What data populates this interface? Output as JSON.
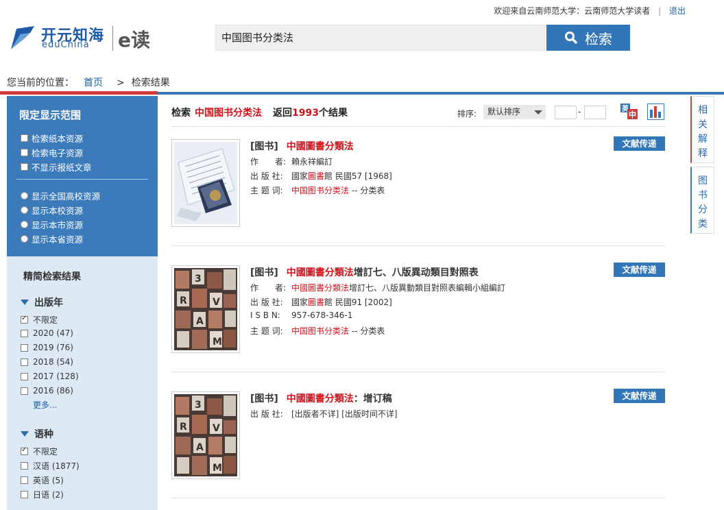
{
  "topbar": {
    "welcome": "欢迎来自云南师范大学：云南师范大学读者",
    "separator": "|",
    "logout": "退出"
  },
  "logo": {
    "cn_text": "开元知海",
    "en_text": "eduChina",
    "product": "e读"
  },
  "search": {
    "query": "中国图书分类法",
    "button_label": "检索"
  },
  "breadcrumb": {
    "prefix": "您当前的位置：",
    "home": "首页",
    "separator": ">",
    "current": "检索结果"
  },
  "filter_panel": {
    "title": "限定显示范围",
    "checkboxes": [
      "检索纸本资源",
      "检索电子资源",
      "不显示报纸文章"
    ],
    "radios": [
      "显示全国高校资源",
      "显示本校资源",
      "显示本市资源",
      "显示本省资源"
    ]
  },
  "refine_panel": {
    "title": "精简检索结果",
    "year_facet": {
      "label": "出版年",
      "options": [
        "不限定",
        "2020 (47)",
        "2019 (76)",
        "2018 (54)",
        "2017 (128)",
        "2016 (86)"
      ],
      "more": "更多..."
    },
    "lang_facet": {
      "label": "语种",
      "options": [
        "不限定",
        "汉语 (1877)",
        "英语 (5)",
        "日语 (2)"
      ]
    }
  },
  "results_header": {
    "prefix": "检索",
    "keyword": "中国图书分类法",
    "returned": "返回",
    "count": "1993",
    "suffix": "个结果",
    "sort_label": "排序:",
    "sort_value": "默认排序",
    "range_dash": "-"
  },
  "results": [
    {
      "type": "[图书]",
      "title_hl": "中國圖書分類法",
      "title_rest": "",
      "deliver": "文献传递",
      "author_label": "作　　者:",
      "author": "賴永祥編訂",
      "publisher_label": "出 版 社:",
      "publisher_pre": "國家",
      "publisher_hl": "圖書",
      "publisher_post": "館 民國57 [1968]",
      "subject_label": "主 题 词:",
      "subject_hl": "中国图书分类法",
      "subject_rest": "-- 分类表"
    },
    {
      "type": "[图书]",
      "title_hl": "中國圖書分類法",
      "title_rest": "增訂七、八版異动類目對照表",
      "deliver": "文献传递",
      "author_label": "作　　者:",
      "author_hl": "中國圖書分類法",
      "author_rest": "增訂七、八版異動類目對照表編輯小組編訂",
      "publisher_label": "出 版 社:",
      "publisher_pre": "國家",
      "publisher_hl": "圖書",
      "publisher_post": "館 民國91 [2002]",
      "isbn_label": "I S B N:",
      "isbn": "957-678-346-1",
      "subject_label": "主 题 词:",
      "subject_hl": "中国图书分类法",
      "subject_rest": "-- 分类表"
    },
    {
      "type": "[图书]",
      "title_hl": "中國圖書分類法",
      "title_rest": "：增订稿",
      "deliver": "文献传递",
      "publisher_label": "出 版 社:",
      "publisher": "[出版者不详] [出版时间不详]"
    }
  ],
  "side_tabs": {
    "related": "相关解释",
    "classification": "图书分类"
  },
  "colors": {
    "brand_blue": "#3276b8",
    "highlight_red": "#d0101a",
    "panel_blue": "#3b7bbb",
    "refine_bg": "#dde9f5"
  },
  "icons": [
    "search-icon",
    "lang-switch-icon",
    "bar-chart-icon",
    "logo-swoosh-icon"
  ]
}
